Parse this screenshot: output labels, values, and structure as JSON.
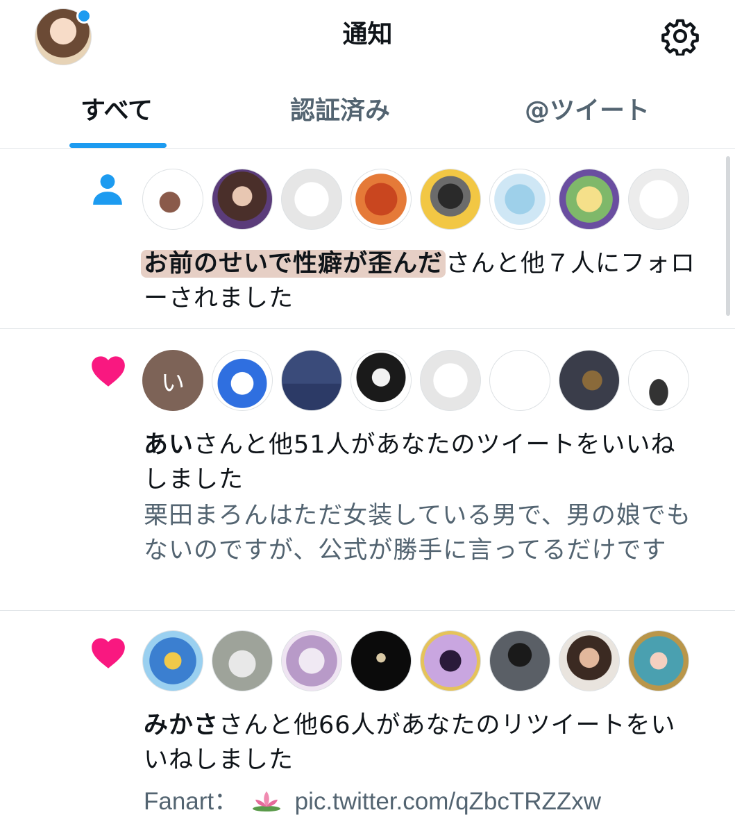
{
  "header": {
    "title": "通知"
  },
  "tabs": [
    {
      "label": "すべて"
    },
    {
      "label": "認証済み"
    },
    {
      "label": "@ツイート"
    }
  ],
  "notifications": [
    {
      "kind_icon": "person-icon",
      "avatars": [
        "avatar-1",
        "avatar-2",
        "avatar-3",
        "avatar-4",
        "avatar-5",
        "avatar-6",
        "avatar-7",
        "avatar-8"
      ],
      "name": "お前のせいで性癖が歪んだ",
      "rest": "さんと他７人にフォローされました"
    },
    {
      "kind_icon": "heart-icon",
      "avatars": [
        "い",
        "avatar-2",
        "avatar-3",
        "avatar-4",
        "avatar-5",
        "avatar-6",
        "avatar-7",
        "avatar-8"
      ],
      "name": "あい",
      "rest": "さんと他51人があなたのツイートをいいねしました",
      "tweet": "栗田まろんはただ女装している男で、男の娘でもないのですが、公式が勝手に言ってるだけです"
    },
    {
      "kind_icon": "heart-icon",
      "avatars": [
        "avatar-1",
        "avatar-2",
        "avatar-3",
        "avatar-4",
        "avatar-5",
        "avatar-6",
        "avatar-7",
        "avatar-8"
      ],
      "name": "みかさ",
      "rest": "さんと他66人があなたのリツイートをいいねしました",
      "tweet_prefix": "Fanart：",
      "tweet_link": "pic.twitter.com/qZbcTRZZxw"
    }
  ],
  "colors": {
    "accent": "#1d9bf0",
    "heart": "#f91880",
    "muted": "#536471"
  }
}
